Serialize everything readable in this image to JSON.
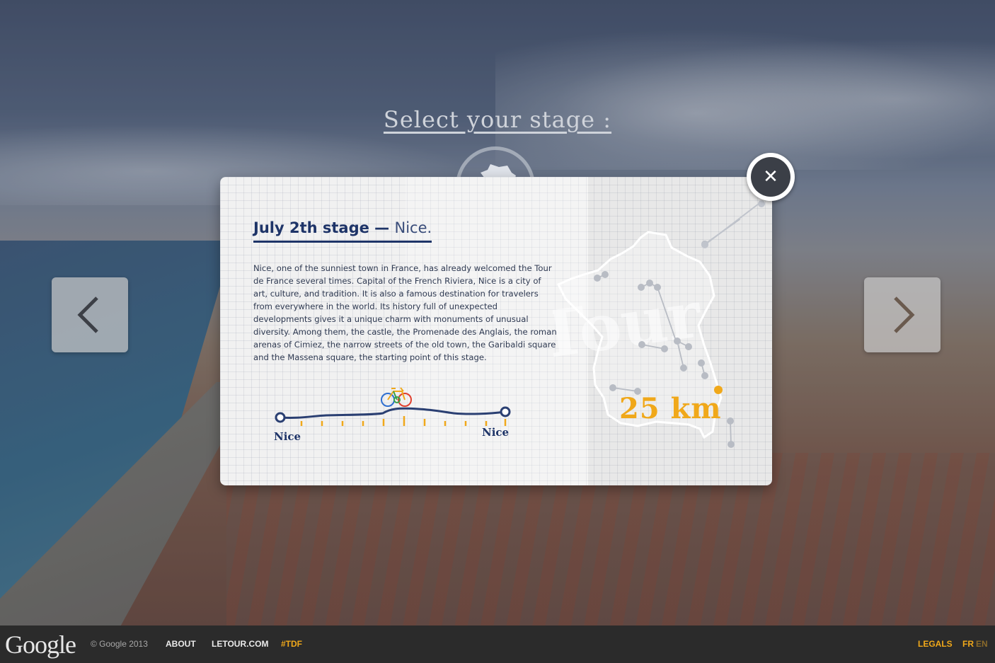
{
  "page": {
    "heading": "Select your stage :"
  },
  "stage_card": {
    "title": "July 2th stage —",
    "city": "Nice.",
    "description": "Nice, one of the sunniest town in France, has already welcomed the Tour de France several times. Capital of the French Riviera, Nice is a city of art, culture, and tradition. It is also a famous destination for travelers from everywhere in the world. Its history full of unexpected developments gives it a unique charm with monuments of unusual diversity. Among them, the castle, the Promenade des Anglais, the roman arenas of Cimiez, the narrow streets of the old town, the Garibaldi square and the Massena square, the starting point of this stage.",
    "start_city": "Nice",
    "end_city": "Nice",
    "distance": "25 km",
    "map_watermark": "Tour"
  },
  "controls": {
    "prev_icon": "chevron-left-icon",
    "next_icon": "chevron-right-icon",
    "close_icon": "close-icon",
    "close_symbol": "✕",
    "map_icon": "france-map-icon"
  },
  "footer": {
    "logo": "Google",
    "copyright": "© Google 2013",
    "about": "ABOUT",
    "letour": "LETOUR.COM",
    "tdf": "#TDF",
    "legals": "LEGALS",
    "lang_fr": "FR",
    "lang_en": "EN"
  },
  "colors": {
    "accent": "#f0a81a",
    "title_blue": "#1e3468",
    "footer_bg": "#2b2b2b"
  }
}
